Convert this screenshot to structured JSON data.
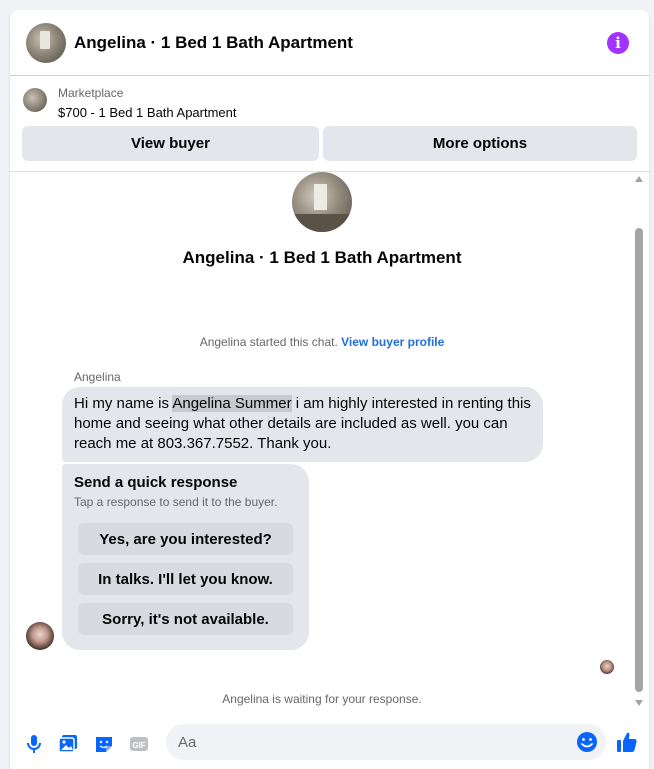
{
  "header": {
    "title": "Angelina · 1 Bed 1 Bath Apartment"
  },
  "marketplace": {
    "label": "Marketplace",
    "listing": "$700 - 1 Bed 1 Bath Apartment",
    "view_buyer_label": "View buyer",
    "more_options_label": "More options"
  },
  "conversation": {
    "title": "Angelina · 1 Bed 1 Bath Apartment",
    "started_text": "Angelina started this chat.",
    "view_profile_link": "View buyer profile",
    "sender_name": "Angelina",
    "message_before": "Hi my name is ",
    "message_highlight": "Angelina Summer",
    "message_after": " i am highly interested in renting this home and seeing what other details are included as well. you can reach me at 803.367.7552. Thank you.",
    "quick_response": {
      "title": "Send a quick response",
      "subtitle": "Tap a response to send it to the buyer.",
      "options": [
        "Yes, are you interested?",
        "In talks. I'll let you know.",
        "Sorry, it's not available."
      ]
    },
    "waiting_text": "Angelina is waiting for your response."
  },
  "composer": {
    "placeholder": "Aa",
    "icons": [
      "microphone-icon",
      "photo-icon",
      "sticker-icon",
      "gif-icon",
      "emoji-icon",
      "like-icon"
    ]
  },
  "colors": {
    "accent": "#0866ff",
    "info": "#a033ff",
    "bubble": "#e4e6eb",
    "link": "#216fdb"
  }
}
